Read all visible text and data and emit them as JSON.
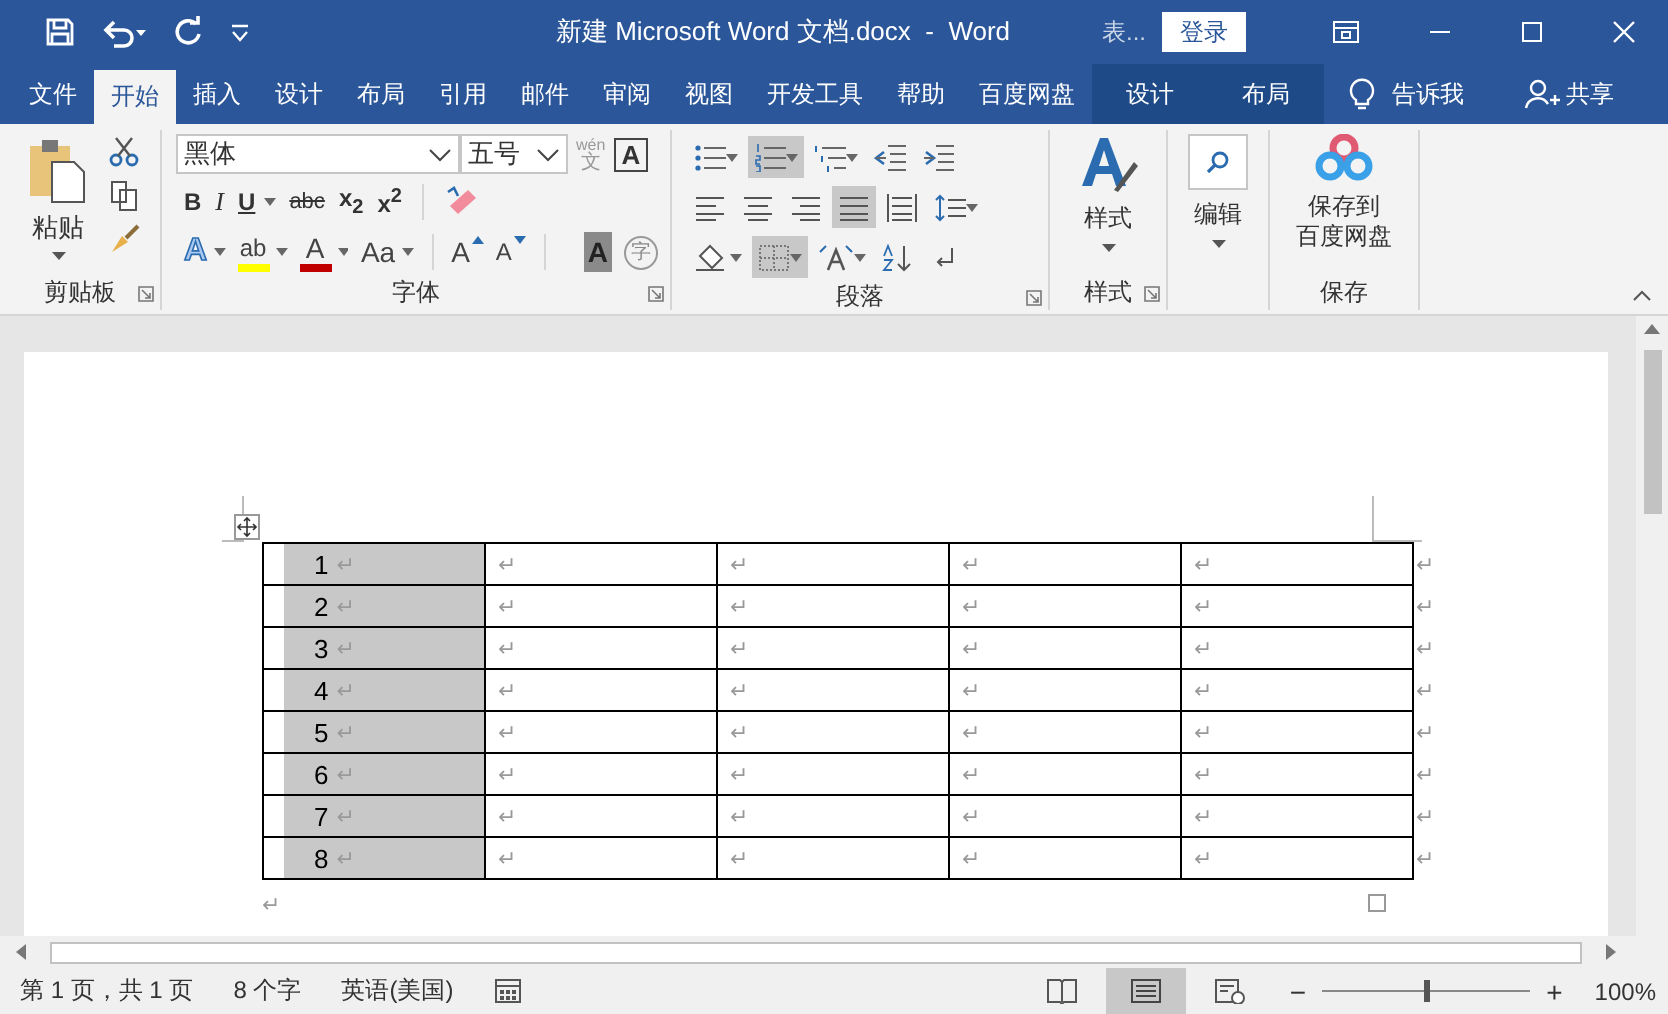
{
  "title_bar": {
    "title": "新建 Microsoft Word 文档.docx  -  Word",
    "context_label": "表...",
    "login": "登录"
  },
  "tabs": [
    {
      "label": "文件",
      "kind": "normal",
      "selected": false
    },
    {
      "label": "开始",
      "kind": "normal",
      "selected": true
    },
    {
      "label": "插入",
      "kind": "normal",
      "selected": false
    },
    {
      "label": "设计",
      "kind": "normal",
      "selected": false
    },
    {
      "label": "布局",
      "kind": "normal",
      "selected": false
    },
    {
      "label": "引用",
      "kind": "normal",
      "selected": false
    },
    {
      "label": "邮件",
      "kind": "normal",
      "selected": false
    },
    {
      "label": "审阅",
      "kind": "normal",
      "selected": false
    },
    {
      "label": "视图",
      "kind": "normal",
      "selected": false
    },
    {
      "label": "开发工具",
      "kind": "normal",
      "selected": false
    },
    {
      "label": "帮助",
      "kind": "normal",
      "selected": false
    },
    {
      "label": "百度网盘",
      "kind": "normal",
      "selected": false
    },
    {
      "label": "设计",
      "kind": "context",
      "selected": false
    },
    {
      "label": "布局",
      "kind": "context",
      "selected": false
    }
  ],
  "tell_me": "告诉我",
  "share": "共享",
  "ribbon": {
    "clipboard": {
      "paste": "粘贴",
      "label": "剪贴板"
    },
    "font": {
      "name": "黑体",
      "size": "五号",
      "phonetic_top": "wén",
      "phonetic_bottom": "文",
      "border_char": "A",
      "label": "字体",
      "row1": [
        {
          "label": "B",
          "kind": "bold",
          "dropdown": false
        },
        {
          "label": "I",
          "kind": "italic",
          "dropdown": false
        },
        {
          "label": "U",
          "kind": "underline",
          "dropdown": true
        },
        {
          "label": "abc",
          "kind": "strike",
          "dropdown": false
        },
        {
          "label": "x$_{2}$",
          "kind": "sub",
          "dropdown": false
        },
        {
          "label": "x$^{2}$",
          "kind": "sup",
          "dropdown": false
        }
      ],
      "row2": [
        {
          "label": "A",
          "kind": "effect",
          "dropdown": true
        },
        {
          "label": "ab",
          "kind": "highlight",
          "color": "#ffff00",
          "dropdown": true
        },
        {
          "label": "A",
          "kind": "color",
          "color": "#c00000",
          "dropdown": true
        },
        {
          "label": "Aa",
          "kind": "case",
          "dropdown": true
        },
        {
          "label": "A",
          "kind": "grow",
          "dropdown": false
        },
        {
          "label": "A",
          "kind": "shrink",
          "dropdown": false
        },
        {
          "label": "A",
          "kind": "shade",
          "dropdown": false
        },
        {
          "label": "字",
          "kind": "enclose",
          "dropdown": false
        }
      ]
    },
    "paragraph": {
      "label": "段落",
      "rows": [
        [
          {
            "kind": "bullets",
            "selected": false,
            "dropdown": true
          },
          {
            "kind": "numbering",
            "selected": true,
            "dropdown": true
          },
          {
            "kind": "multilevel",
            "selected": false,
            "dropdown": true
          },
          {
            "kind": "outdent",
            "selected": false,
            "dropdown": false
          },
          {
            "kind": "indent",
            "selected": false,
            "dropdown": false
          }
        ],
        [
          {
            "kind": "left",
            "selected": false,
            "dropdown": false
          },
          {
            "kind": "center",
            "selected": false,
            "dropdown": false
          },
          {
            "kind": "right",
            "selected": false,
            "dropdown": false
          },
          {
            "kind": "justify",
            "selected": true,
            "dropdown": false
          },
          {
            "kind": "distributed",
            "selected": false,
            "dropdown": false
          },
          {
            "kind": "spacing",
            "selected": false,
            "dropdown": true
          }
        ],
        [
          {
            "kind": "shading",
            "selected": false,
            "dropdown": true
          },
          {
            "kind": "borders",
            "selected": true,
            "dropdown": true
          },
          {
            "kind": "layout",
            "selected": false,
            "dropdown": true
          },
          {
            "kind": "sort",
            "selected": false,
            "dropdown": false
          },
          {
            "kind": "marks",
            "selected": false,
            "dropdown": false
          }
        ]
      ]
    },
    "styles": {
      "button": "样式",
      "label": "样式"
    },
    "editing": {
      "button": "编辑"
    },
    "save": {
      "lines": [
        "保存到",
        "百度网盘"
      ],
      "label": "保存"
    }
  },
  "document": {
    "rows": [
      {
        "number": "1",
        "mark": "↵",
        "cells": [
          "↵",
          "↵",
          "↵",
          "↵"
        ],
        "row_end": "↵",
        "selected": true
      },
      {
        "number": "2",
        "mark": "↵",
        "cells": [
          "↵",
          "↵",
          "↵",
          "↵"
        ],
        "row_end": "↵",
        "selected": true
      },
      {
        "number": "3",
        "mark": "↵",
        "cells": [
          "↵",
          "↵",
          "↵",
          "↵"
        ],
        "row_end": "↵",
        "selected": true
      },
      {
        "number": "4",
        "mark": "↵",
        "cells": [
          "↵",
          "↵",
          "↵",
          "↵"
        ],
        "row_end": "↵",
        "selected": true
      },
      {
        "number": "5",
        "mark": "↵",
        "cells": [
          "↵",
          "↵",
          "↵",
          "↵"
        ],
        "row_end": "↵",
        "selected": true
      },
      {
        "number": "6",
        "mark": "↵",
        "cells": [
          "↵",
          "↵",
          "↵",
          "↵"
        ],
        "row_end": "↵",
        "selected": true
      },
      {
        "number": "7",
        "mark": "↵",
        "cells": [
          "↵",
          "↵",
          "↵",
          "↵"
        ],
        "row_end": "↵",
        "selected": true
      },
      {
        "number": "8",
        "mark": "↵",
        "cells": [
          "↵",
          "↵",
          "↵",
          "↵"
        ],
        "row_end": "↵",
        "selected": true
      }
    ],
    "after_table": "↵"
  },
  "status_bar": {
    "page": "第 1 页，共 1 页",
    "words": "8 个字",
    "language": "英语(美国)",
    "views": [
      {
        "kind": "read",
        "selected": false
      },
      {
        "kind": "print",
        "selected": true
      },
      {
        "kind": "web",
        "selected": false
      }
    ],
    "zoom_minus": "−",
    "zoom_plus": "+",
    "zoom": {
      "level": 0.5
    },
    "zoom_label": "100%"
  }
}
